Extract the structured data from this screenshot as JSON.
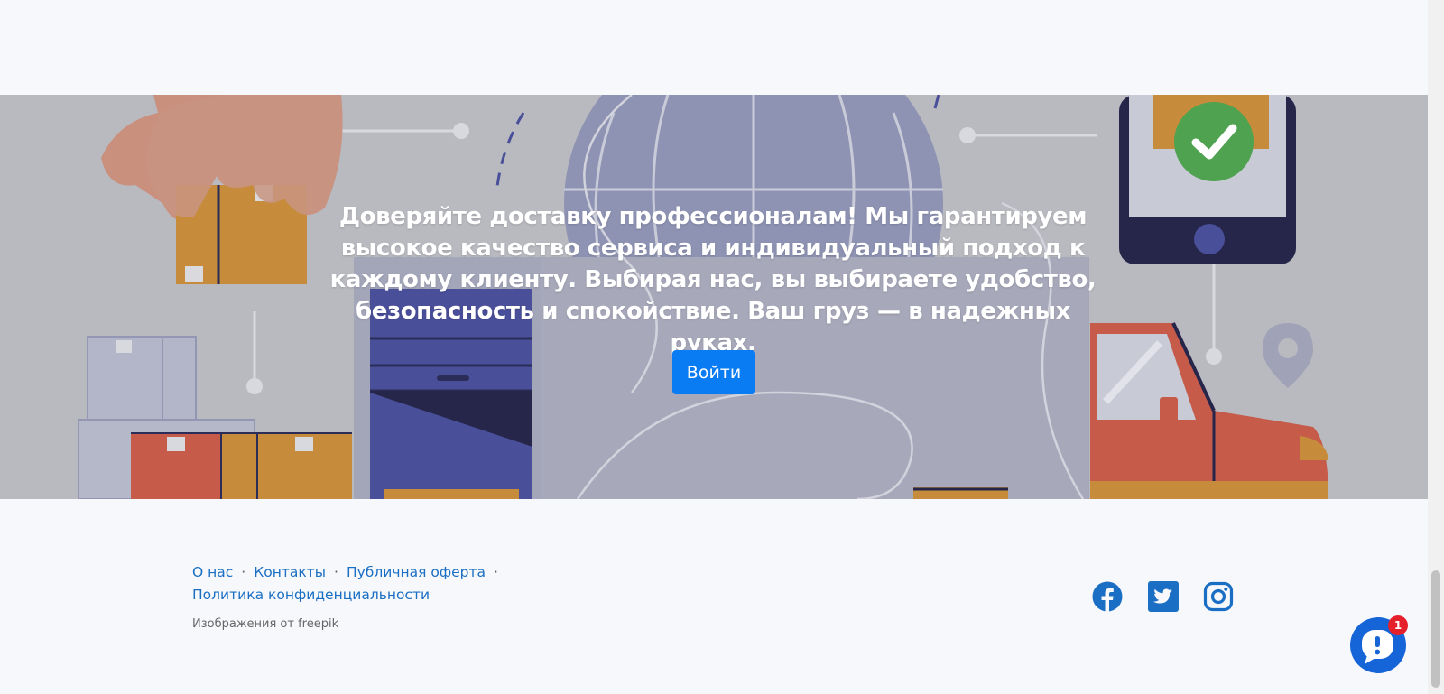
{
  "hero": {
    "text": "Доверяйте доставку профессионалам! Мы гарантируем высокое качество сервиса и индивидуальный подход к каждому клиенту. Выбирая нас, вы выбираете удобство, безопасность и спокойствие. Ваш груз — в надежных руках.",
    "login_label": "Войти",
    "login_color": "#0a7cf3"
  },
  "footer": {
    "links": [
      "О нас",
      "Контакты",
      "Публичная оферта",
      "Политика конфиденциальности"
    ],
    "separator": "·",
    "credit": "Изображения от freepik",
    "social": [
      "facebook-icon",
      "twitter-icon",
      "instagram-icon"
    ],
    "social_color": "#1a6fc4"
  },
  "chat": {
    "badge_count": "1",
    "icon": "chat-bubble-icon"
  }
}
